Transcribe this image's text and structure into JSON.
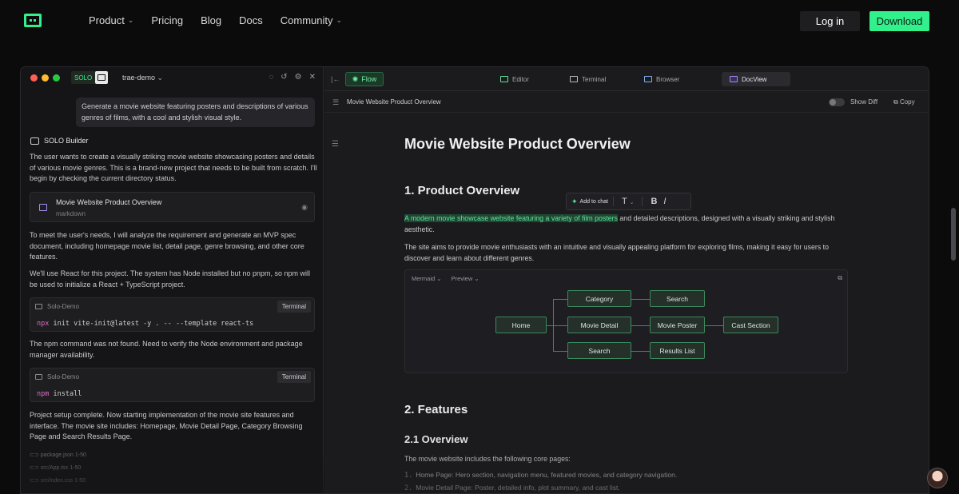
{
  "nav": {
    "links": [
      {
        "label": "Product",
        "dropdown": true
      },
      {
        "label": "Pricing",
        "dropdown": false
      },
      {
        "label": "Blog",
        "dropdown": false
      },
      {
        "label": "Docs",
        "dropdown": false
      },
      {
        "label": "Community",
        "dropdown": true
      }
    ],
    "login": "Log in",
    "download": "Download",
    "accent_color": "#32f08c"
  },
  "left": {
    "solo_label": "SOLO",
    "project": "trae-demo",
    "user_prompt": "Generate a movie website featuring posters and descriptions of various genres of films, with a cool and stylish visual style.",
    "builder_name": "SOLO Builder",
    "para1": "The user wants to create a visually striking movie website showcasing posters and details of various movie genres. This is a brand-new project that needs to be built from scratch. I'll begin by checking the current directory status.",
    "doc_card": {
      "title": "Movie Website Product Overview",
      "type": "markdown"
    },
    "para2": "To meet the user's needs, I will analyze the requirement and generate an MVP spec document, including homepage movie list, detail page, genre browsing, and other core features.",
    "para3": "We'll use React for this project. The system has Node installed but no pnpm, so npm will be used to initialize a React + TypeScript project.",
    "terminal1": {
      "title": "Solo-Demo",
      "button": "Terminal",
      "cmd": "npx",
      "args": "init vite-init@latest -y . -- --template react-ts"
    },
    "para4": "The npm command was not found. Need to verify the Node environment and package manager availability.",
    "terminal2": {
      "title": "Solo-Demo",
      "button": "Terminal",
      "cmd": "npm",
      "args": "install"
    },
    "para5": "Project setup complete. Now starting implementation of the movie site features and interface. The movie site includes: Homepage, Movie Detail Page, Category Browsing Page and Search Results Page.",
    "files": [
      "package.json 1-50",
      "src/App.tsx 1-50",
      "src/index.css 1-50"
    ]
  },
  "right": {
    "flow_label": "Flow",
    "tabs": [
      {
        "label": "Editor",
        "active": false
      },
      {
        "label": "Terminal",
        "active": false
      },
      {
        "label": "Browser",
        "active": false
      },
      {
        "label": "DocView",
        "active": true
      }
    ],
    "doc_title_bar": "Movie Website Product Overview",
    "show_diff": "Show Diff",
    "copy": "Copy",
    "h1": "Movie Website Product Overview",
    "h2_overview": "1. Product Overview",
    "popup": {
      "add_to_chat": "Add to chat",
      "t": "T",
      "b": "B",
      "i": "I"
    },
    "highlight": "A modern movie showcase website featuring a variety of film posters",
    "p1_rest": " and detailed descriptions, designed with a visually striking and stylish aesthetic.",
    "p2": "The site aims to provide movie enthusiasts with an intuitive and visually appealing platform for exploring films, making it easy for users to discover and learn about different genres.",
    "diagram": {
      "mode": "Mermaid",
      "view": "Preview",
      "nodes": {
        "home": "Home",
        "category": "Category",
        "movie_detail": "Movie Detail",
        "search_mid": "Search",
        "search_top": "Search",
        "movie_poster": "Movie Poster",
        "results": "Results List",
        "cast": "Cast Section"
      }
    },
    "h2_features": "2. Features",
    "h3_overview": "2.1 Overview",
    "p3": "The movie website includes the following core pages:",
    "list": [
      {
        "n": "1.",
        "text": "Home Page: Hero section, navigation menu, featured movies, and category navigation."
      },
      {
        "n": "2.",
        "text": "Movie Detail Page: Poster, detailed info, plot summary, and cast list."
      }
    ]
  }
}
